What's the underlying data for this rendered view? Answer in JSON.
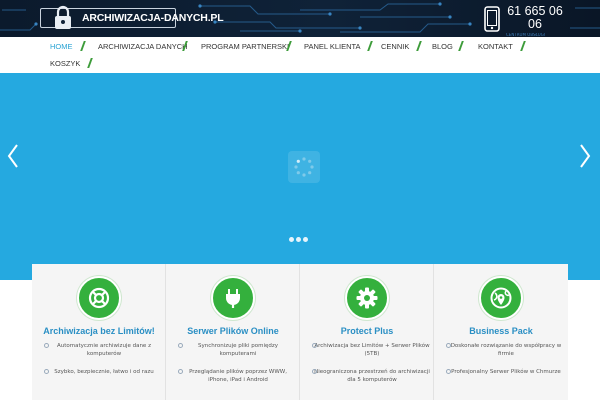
{
  "header": {
    "logo_text": "ARCHIWIZACJA-DANYCH.PL",
    "phone_line1": "61 665 06",
    "phone_line2": "06",
    "phone_sub": "CENTRUM OBSŁUGI"
  },
  "nav": {
    "items": [
      {
        "label": "Home"
      },
      {
        "label": "Archiwizacja Danych"
      },
      {
        "label": "Program Partnerski"
      },
      {
        "label": "Panel Klienta"
      },
      {
        "label": "Cennik"
      },
      {
        "label": "Blog"
      },
      {
        "label": "Kontakt"
      },
      {
        "label": "Koszyk"
      }
    ]
  },
  "slider": {
    "background_color": "#25a9e0",
    "dots_count": 3
  },
  "features": [
    {
      "title": "Archiwizacja bez Limitów!",
      "icon": "lifebuoy-icon",
      "items": [
        "Automatycznie archiwizuje dane z komputerów",
        "Szybko, bezpiecznie, łatwo i od razu"
      ]
    },
    {
      "title": "Serwer Plików Online",
      "icon": "plug-icon",
      "items": [
        "Synchronizuje pliki pomiędzy komputerami",
        "Przeglądanie plików poprzez WWW, iPhone, iPad i Android"
      ]
    },
    {
      "title": "Protect Plus",
      "icon": "gear-icon",
      "items": [
        "Archiwizacja bez Limitów + Serwer Plików (5TB)",
        "Nieograniczona przestrzeń do archiwizacji dla 5 komputerów"
      ]
    },
    {
      "title": "Business Pack",
      "icon": "globe-pin-icon",
      "items": [
        "Doskonałe rozwiązanie do współpracy w firmie",
        "Profesjonalny Serwer Plików w Chmurze"
      ]
    }
  ],
  "colors": {
    "accent_green": "#34b03d",
    "title_blue": "#2a8fc4",
    "nav_active": "#2aa4d4"
  }
}
